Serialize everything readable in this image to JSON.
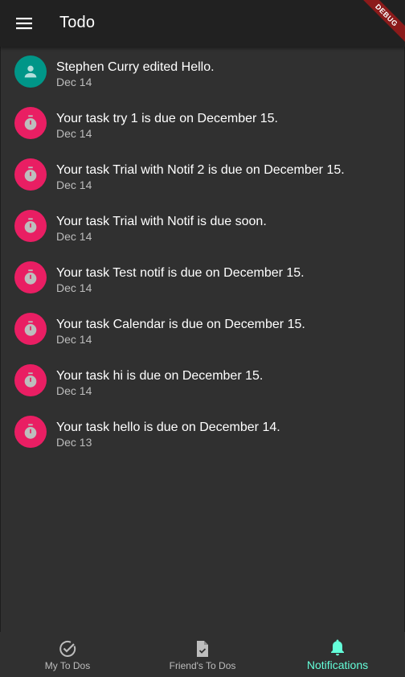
{
  "appbar": {
    "title": "Todo",
    "menu_icon": "menu-icon",
    "debug_banner": "DEBUG"
  },
  "notifications": [
    {
      "title": "Stephen Curry edited Hello.",
      "date": "Dec 14",
      "icon": "person-icon",
      "color": "#009688"
    },
    {
      "title": "Your task try 1 is due on December 15.",
      "date": "Dec 14",
      "icon": "timer-icon",
      "color": "#e91e63"
    },
    {
      "title": "Your task Trial with Notif 2 is due on December 15.",
      "date": "Dec 14",
      "icon": "timer-icon",
      "color": "#e91e63"
    },
    {
      "title": "Your task Trial with Notif is due soon.",
      "date": "Dec 14",
      "icon": "timer-icon",
      "color": "#e91e63"
    },
    {
      "title": "Your task Test notif is due on December 15.",
      "date": "Dec 14",
      "icon": "timer-icon",
      "color": "#e91e63"
    },
    {
      "title": "Your task Calendar is due on December 15.",
      "date": "Dec 14",
      "icon": "timer-icon",
      "color": "#e91e63"
    },
    {
      "title": "Your task hi is due on December 15.",
      "date": "Dec 14",
      "icon": "timer-icon",
      "color": "#e91e63"
    },
    {
      "title": "Your task hello is due on December 14.",
      "date": "Dec 13",
      "icon": "timer-icon",
      "color": "#e91e63"
    }
  ],
  "bottom_nav": {
    "items": [
      {
        "label": "My To Dos",
        "icon": "check-circle-icon",
        "active": false
      },
      {
        "label": "Friend's To Dos",
        "icon": "document-check-icon",
        "active": false
      },
      {
        "label": "Notifications",
        "icon": "bell-icon",
        "active": true
      }
    ]
  },
  "colors": {
    "background": "#303030",
    "appbar": "#212121",
    "accent": "#64ffda",
    "person_avatar": "#009688",
    "timer_avatar": "#e91e63"
  }
}
